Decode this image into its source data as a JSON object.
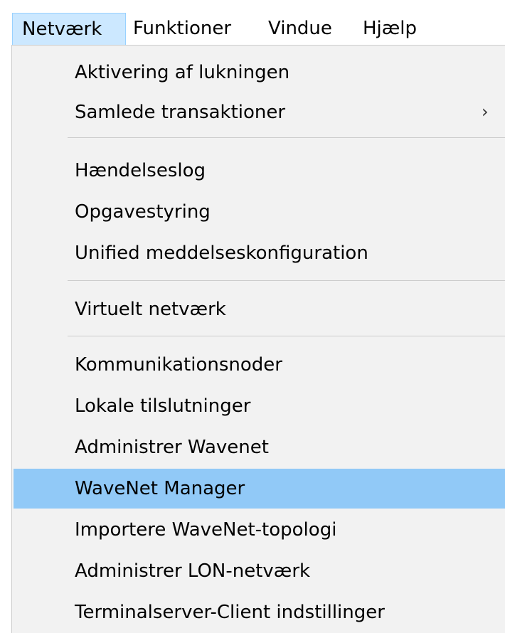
{
  "menubar": {
    "items": [
      {
        "label": "Netværk",
        "active": true
      },
      {
        "label": "Funktioner",
        "active": false
      },
      {
        "label": "Vindue",
        "active": false
      },
      {
        "label": "Hjælp",
        "active": false
      }
    ]
  },
  "dropdown": {
    "groups": [
      {
        "items": [
          {
            "label": "Aktivering af lukningen"
          },
          {
            "label": "Samlede transaktioner",
            "submenu": true,
            "submenu_icon": "chevron-right-icon"
          }
        ]
      },
      {
        "items": [
          {
            "label": "Hændelseslog"
          },
          {
            "label": "Opgavestyring"
          },
          {
            "label": "Unified meddelseskonfiguration"
          }
        ]
      },
      {
        "items": [
          {
            "label": "Virtuelt netværk"
          }
        ]
      },
      {
        "items": [
          {
            "label": "Kommunikationsnoder"
          },
          {
            "label": "Lokale tilslutninger"
          },
          {
            "label": "Administrer Wavenet"
          },
          {
            "label": "WaveNet Manager",
            "highlighted": true
          },
          {
            "label": "Importere WaveNet-topologi"
          },
          {
            "label": "Administrer LON-netværk"
          },
          {
            "label": "Terminalserver-Client indstillinger"
          }
        ]
      }
    ]
  },
  "colors": {
    "menubar_active_bg": "#cce8ff",
    "menu_bg": "#f2f2f2",
    "highlight_bg": "#91c9f7"
  }
}
